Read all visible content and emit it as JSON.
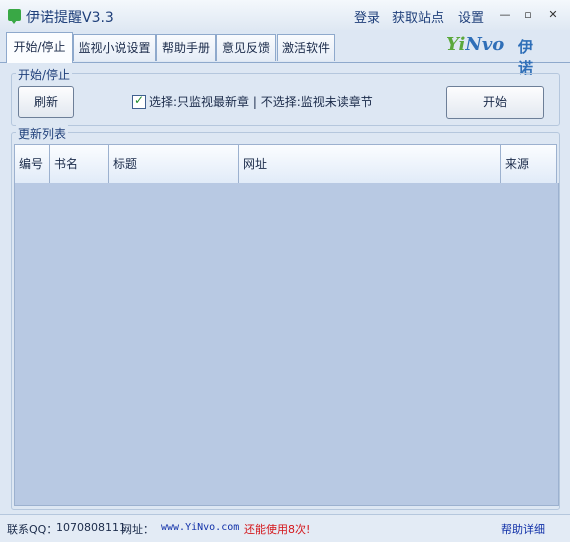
{
  "window": {
    "title": "伊诺提醒V3.3"
  },
  "topmenu": {
    "login": "登录",
    "fetch_sites": "获取站点",
    "settings": "设置"
  },
  "window_controls": {
    "min": "—",
    "max": "▫",
    "close": "✕"
  },
  "tabs": [
    {
      "label": "开始/停止"
    },
    {
      "label": "监视小说设置"
    },
    {
      "label": "帮助手册"
    },
    {
      "label": "意见反馈"
    },
    {
      "label": "激活软件"
    }
  ],
  "logo": {
    "latin_yi": "Yi",
    "latin_nvo": "Nvo",
    "cn": "伊诺"
  },
  "start_group": {
    "title": "开始/停止",
    "refresh_label": "刷新",
    "check_label": "选择:只监视最新章 | 不选择:监视未读章节",
    "checked": true,
    "start_label": "开始"
  },
  "list_group": {
    "title": "更新列表",
    "columns": [
      "编号",
      "书名",
      "标题",
      "网址",
      "来源"
    ]
  },
  "status": {
    "contact_label": "联系QQ：",
    "qq": "1070808111",
    "url_label": "网址：",
    "url": "www.YiNvo.com",
    "usage": "还能使用8次!",
    "help": "帮助详细"
  },
  "colors": {
    "accent": "#1f3f7a",
    "table_bg": "#b8c9e3",
    "warning": "#d4161b",
    "link": "#1030a8"
  }
}
